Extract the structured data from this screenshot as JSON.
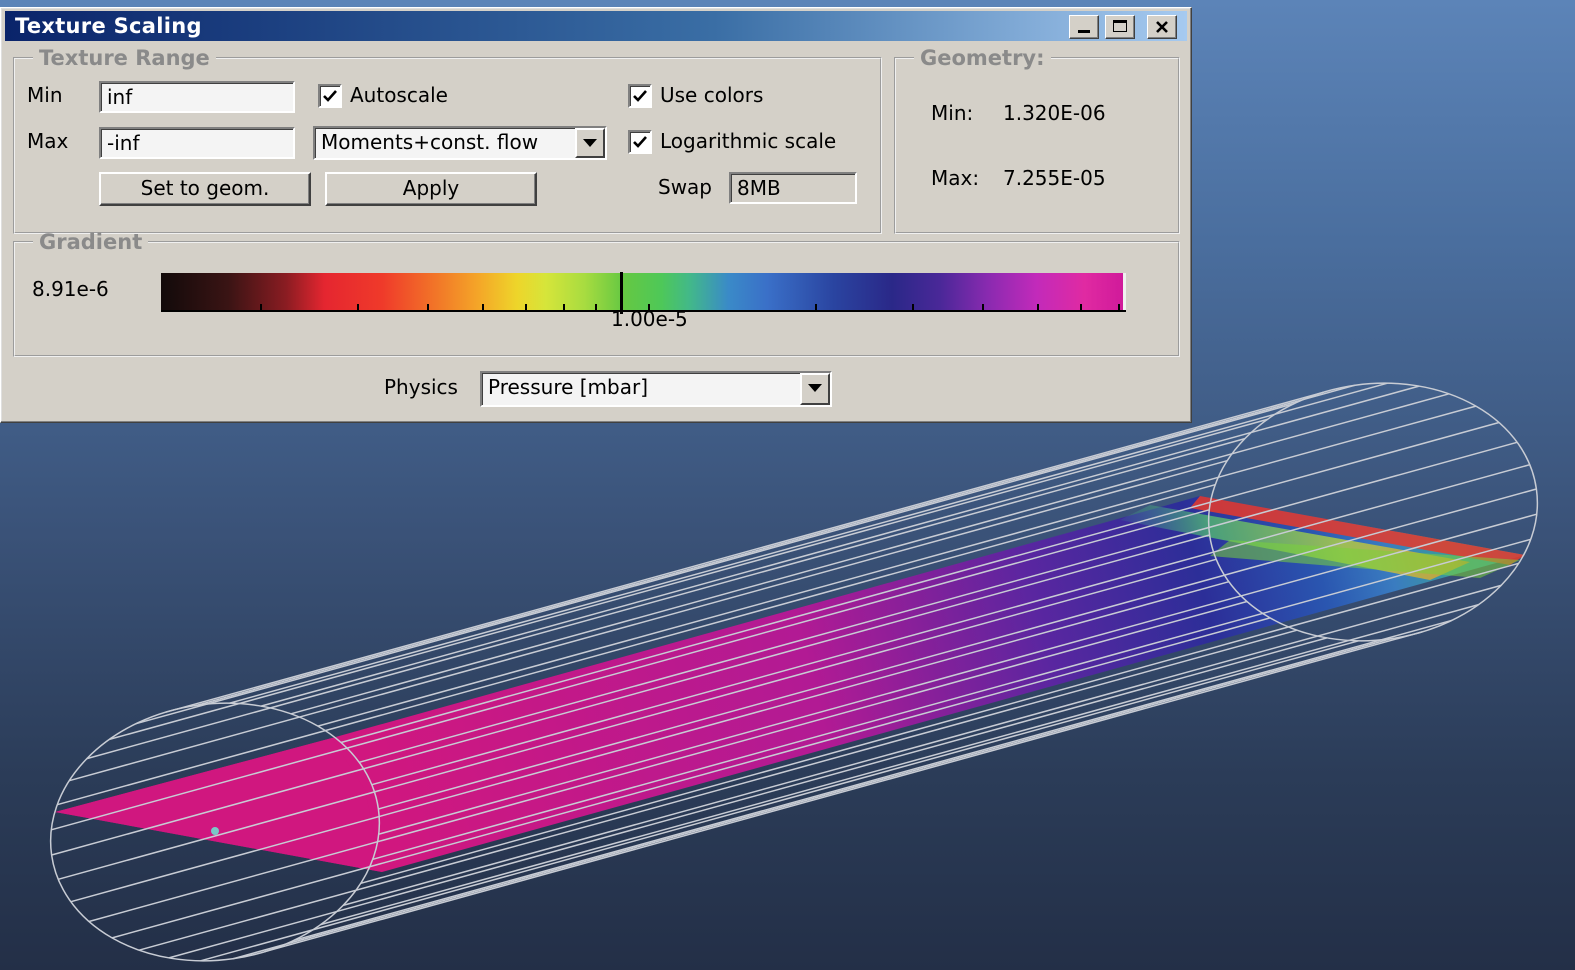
{
  "window": {
    "title": "Texture Scaling"
  },
  "texture_range": {
    "legend": "Texture Range",
    "min_label": "Min",
    "min_value": "inf",
    "max_label": "Max",
    "max_value": "-inf",
    "autoscale_label": "Autoscale",
    "autoscale_checked": true,
    "mode_value": "Moments+const. flow",
    "use_colors_label": "Use colors",
    "use_colors_checked": true,
    "log_scale_label": "Logarithmic scale",
    "log_scale_checked": true,
    "set_to_geom_label": "Set to geom.",
    "apply_label": "Apply",
    "swap_label": "Swap",
    "swap_value": "8MB"
  },
  "geometry": {
    "legend": "Geometry:",
    "min_label": "Min:",
    "min_value": "1.320E-06",
    "max_label": "Max:",
    "max_value": "7.255E-05"
  },
  "gradient": {
    "legend": "Gradient",
    "min_value": "8.91e-6",
    "tick_label": "1.00e-5"
  },
  "physics": {
    "label": "Physics",
    "value": "Pressure [mbar]"
  },
  "colors": {
    "pipe_texture": "#d0177f",
    "wireframe": "#c8ccd4",
    "background_top": "#5c84b8",
    "background_bottom": "#232f47"
  }
}
